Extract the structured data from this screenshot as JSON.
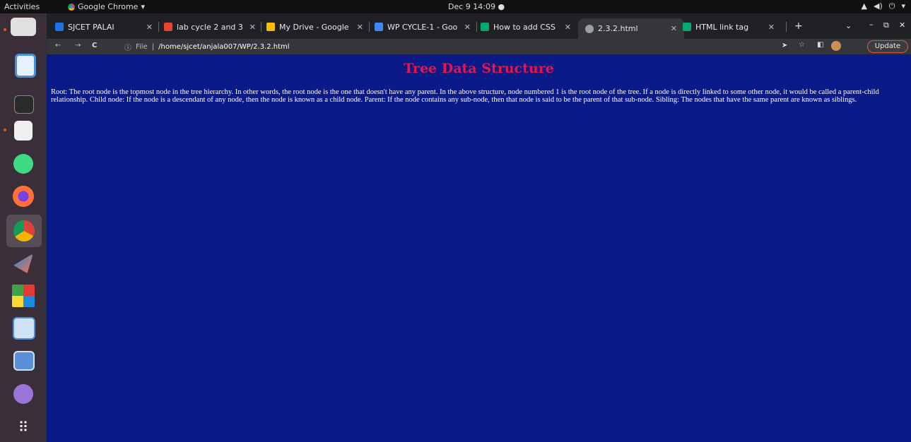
{
  "system": {
    "activities": "Activities",
    "app_name": "Google Chrome",
    "clock": "Dec 9  14:09"
  },
  "tabs": [
    {
      "label": "SJCET PALAI",
      "color": "#1a73e8"
    },
    {
      "label": "lab cycle 2 and 3",
      "color": "#ea4335"
    },
    {
      "label": "My Drive - Google",
      "color": "#fbbc04"
    },
    {
      "label": "WP CYCLE-1 - Goo",
      "color": "#4285f4"
    },
    {
      "label": "How to add CSS",
      "color": "#04aa6d"
    },
    {
      "label": "2.3.2.html",
      "color": "#9aa0a6"
    },
    {
      "label": "HTML link tag",
      "color": "#04aa6d"
    }
  ],
  "address": {
    "scheme_label": "File",
    "url": "/home/sjcet/anjala007/WP/2.3.2.html"
  },
  "toolbar": {
    "update_label": "Update"
  },
  "page": {
    "title": "Tree Data Structure",
    "body": "Root: The root node is the topmost node in the tree hierarchy. In other words, the root node is the one that doesn't have any parent. In the above structure, node numbered 1 is the root node of the tree. If a node is directly linked to some other node, it would be called a parent-child relationship. Child node: If the node is a descendant of any node, then the node is known as a child node. Parent: If the node contains any sub-node, then that node is said to be the parent of that sub-node. Sibling: The nodes that have the same parent are known as siblings."
  },
  "colors": {
    "page_bg": "#0a1a88",
    "title": "#e8154c",
    "dock_bg": "#3a2f38"
  }
}
